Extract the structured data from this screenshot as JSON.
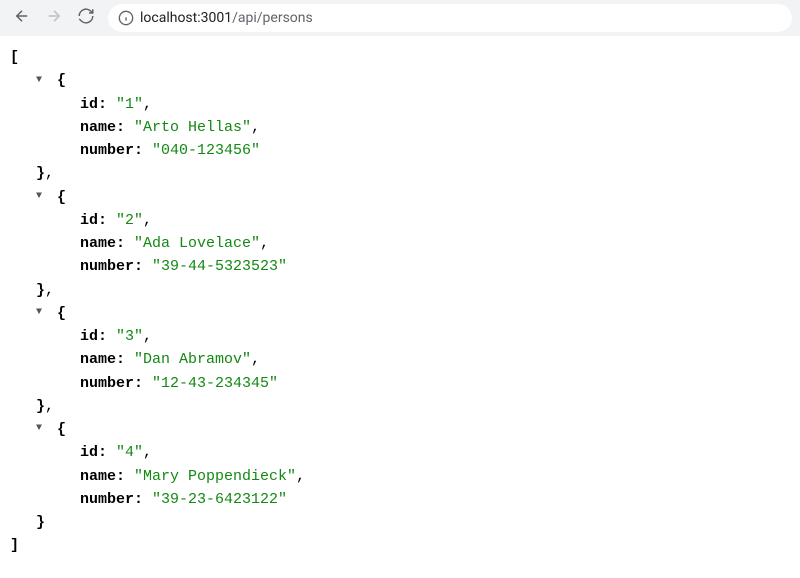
{
  "url": {
    "host": "localhost:3001",
    "path": "/api/persons"
  },
  "keys": {
    "id": "id",
    "name": "name",
    "number": "number"
  },
  "persons": [
    {
      "id": "1",
      "name": "Arto Hellas",
      "number": "040-123456"
    },
    {
      "id": "2",
      "name": "Ada Lovelace",
      "number": "39-44-5323523"
    },
    {
      "id": "3",
      "name": "Dan Abramov",
      "number": "12-43-234345"
    },
    {
      "id": "4",
      "name": "Mary Poppendieck",
      "number": "39-23-6423122"
    }
  ]
}
